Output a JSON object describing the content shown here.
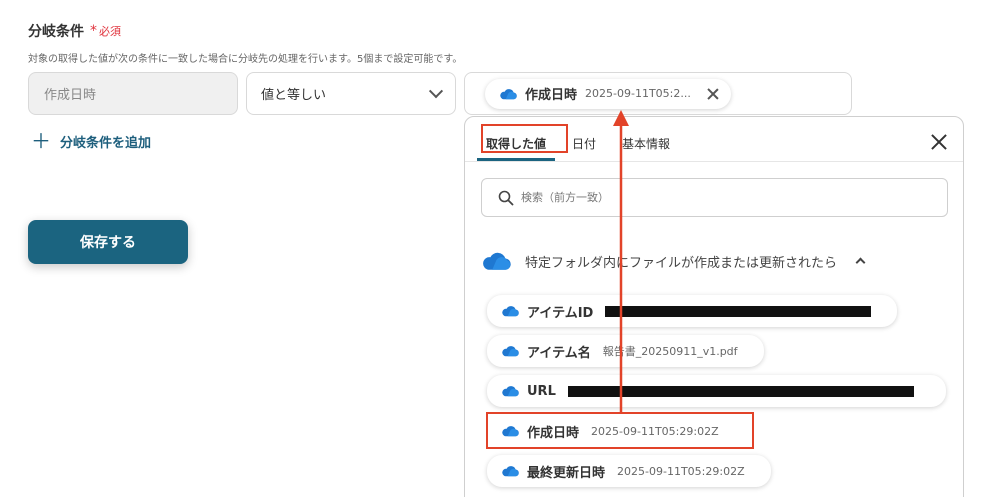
{
  "section": {
    "label": "分岐条件",
    "required_star": "*",
    "required_text": "必須",
    "description": "対象の取得した値が次の条件に一致した場合に分岐先の処理を行います。5個まで設定可能です。"
  },
  "condition": {
    "field_a": "作成日時",
    "operator": "値と等しい",
    "value_chip": {
      "label": "作成日時",
      "value": "2025-09-11T05:2..."
    }
  },
  "add_condition": {
    "icon": "plus-icon",
    "label": "分岐条件を追加"
  },
  "save_button": {
    "label": "保存する"
  },
  "panel": {
    "tabs": [
      {
        "label": "取得した値",
        "active": true
      },
      {
        "label": "日付",
        "active": false
      },
      {
        "label": "基本情報",
        "active": false
      }
    ],
    "search_placeholder": "検索（前方一致）",
    "group_title": "特定フォルダ内にファイルが作成または更新されたら",
    "items": [
      {
        "label": "アイテムID",
        "value": "",
        "redacted": true
      },
      {
        "label": "アイテム名",
        "value": "報告書_20250911_v1.pdf",
        "redacted": false
      },
      {
        "label": "URL",
        "value": "",
        "redacted": true
      },
      {
        "label": "作成日時",
        "value": "2025-09-11T05:29:02Z",
        "redacted": false
      },
      {
        "label": "最終更新日時",
        "value": "2025-09-11T05:29:02Z",
        "redacted": false
      }
    ]
  },
  "colors": {
    "primary": "#1b6480",
    "highlight": "#e24329",
    "cloud": "#1f78d1"
  }
}
